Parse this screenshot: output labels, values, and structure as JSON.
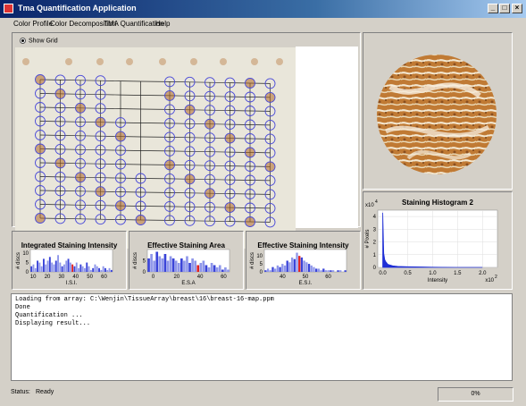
{
  "window": {
    "title": "Tma Quantification Application",
    "minimize_label": "_",
    "maximize_label": "□",
    "close_label": "×"
  },
  "menu": {
    "items": [
      "Color Profile",
      "Color Decomposition",
      "TMA Quantification",
      "Help"
    ]
  },
  "grid_panel": {
    "show_grid_label": "Show Grid",
    "show_grid_checked": true
  },
  "colors": {
    "grid_circle": "#4a4ad8",
    "stain": "#b06a2a",
    "hist_blue": "#1f2fd6",
    "highlight_red": "#e02020"
  },
  "histograms": [
    {
      "title": "Integrated Staining Intensity",
      "ylabel": "# discs",
      "xlabel": "I.S.I.",
      "xticks": [
        "10",
        "20",
        "30",
        "40",
        "50",
        "60"
      ],
      "yticks": [
        "0",
        "5",
        "10"
      ],
      "values": [
        3,
        4,
        2,
        6,
        5,
        3,
        7,
        4,
        6,
        8,
        5,
        4,
        6,
        9,
        5,
        3,
        4,
        6,
        7,
        5,
        4,
        3,
        5,
        2,
        4,
        3,
        2,
        5,
        3,
        1,
        2,
        4,
        3,
        2,
        1,
        3,
        2,
        1,
        2,
        1
      ],
      "highlight_index": 20
    },
    {
      "title": "Effective Staining Area",
      "ylabel": "# discs",
      "xlabel": "E.S.A",
      "xticks": [
        "0",
        "20",
        "40",
        "60"
      ],
      "yticks": [
        "0",
        "5"
      ],
      "values": [
        6,
        8,
        5,
        9,
        7,
        6,
        8,
        5,
        7,
        6,
        5,
        4,
        6,
        5,
        7,
        4,
        6,
        5,
        3,
        4,
        5,
        3,
        2,
        4,
        3,
        2,
        3,
        1,
        2,
        1
      ],
      "highlight_index": 18
    },
    {
      "title": "Effective Staining Intensity",
      "ylabel": "# discs",
      "xlabel": "E.S.I.",
      "xticks": [
        "40",
        "50",
        "60"
      ],
      "yticks": [
        "0",
        "5",
        "10"
      ],
      "values": [
        1,
        2,
        1,
        3,
        2,
        4,
        3,
        5,
        4,
        7,
        6,
        9,
        8,
        12,
        10,
        9,
        7,
        6,
        5,
        4,
        3,
        2,
        2,
        1,
        2,
        1,
        1,
        1,
        1,
        0,
        1,
        1,
        0,
        1
      ],
      "highlight_index": 14
    }
  ],
  "staining_histogram": {
    "title": "Staining Histogram 2",
    "ylabel": "# Pixels",
    "xlabel": "Intensity",
    "y_multiplier": "x10",
    "y_multiplier_exp": "4",
    "x_multiplier": "x10",
    "x_multiplier_exp": "2",
    "xticks": [
      "0.0",
      "0.5",
      "1.0",
      "1.5",
      "2.0"
    ],
    "yticks": [
      "0",
      "1",
      "2",
      "3",
      "4"
    ],
    "ylim": [
      0,
      4.5
    ],
    "xlim": [
      -0.1,
      2.3
    ]
  },
  "chart_data": [
    {
      "type": "bar",
      "title": "Integrated Staining Intensity",
      "xlabel": "I.S.I.",
      "ylabel": "# discs",
      "x_range": [
        8,
        66
      ],
      "ylim": [
        0,
        12
      ],
      "values": [
        3,
        4,
        2,
        6,
        5,
        3,
        7,
        4,
        6,
        8,
        5,
        4,
        6,
        9,
        5,
        3,
        4,
        6,
        7,
        5,
        4,
        3,
        5,
        2,
        4,
        3,
        2,
        5,
        3,
        1,
        2,
        4,
        3,
        2,
        1,
        3,
        2,
        1,
        2,
        1
      ]
    },
    {
      "type": "bar",
      "title": "Effective Staining Area",
      "xlabel": "E.S.A",
      "ylabel": "# discs",
      "x_range": [
        -5,
        65
      ],
      "ylim": [
        0,
        10
      ],
      "values": [
        6,
        8,
        5,
        9,
        7,
        6,
        8,
        5,
        7,
        6,
        5,
        4,
        6,
        5,
        7,
        4,
        6,
        5,
        3,
        4,
        5,
        3,
        2,
        4,
        3,
        2,
        3,
        1,
        2,
        1
      ]
    },
    {
      "type": "bar",
      "title": "Effective Staining Intensity",
      "xlabel": "E.S.I.",
      "ylabel": "# discs",
      "x_range": [
        32,
        68
      ],
      "ylim": [
        0,
        14
      ],
      "values": [
        1,
        2,
        1,
        3,
        2,
        4,
        3,
        5,
        4,
        7,
        6,
        9,
        8,
        12,
        10,
        9,
        7,
        6,
        5,
        4,
        3,
        2,
        2,
        1,
        2,
        1,
        1,
        1,
        1,
        0,
        1,
        1,
        0,
        1
      ]
    },
    {
      "type": "area",
      "title": "Staining Histogram 2",
      "xlabel": "Intensity",
      "ylabel": "# Pixels",
      "xlim": [
        -0.1,
        2.3
      ],
      "ylim": [
        0,
        4.5
      ],
      "x": [
        0.0,
        0.02,
        0.04,
        0.06,
        0.08,
        0.1,
        0.15,
        0.2,
        0.3,
        0.5,
        0.8,
        1.0,
        1.2,
        1.5,
        2.0
      ],
      "y": [
        4.3,
        1.1,
        0.6,
        0.45,
        0.35,
        0.25,
        0.18,
        0.12,
        0.08,
        0.05,
        0.03,
        0.02,
        0.01,
        0.0,
        0.0
      ]
    }
  ],
  "console": {
    "lines": [
      "Loading from array: C:\\Wenjin\\TissueArray\\breast\\16\\breast-16-map.ppm",
      "Done",
      "Quantification ...",
      "Displaying result..."
    ]
  },
  "status": {
    "label": "Status:",
    "value": "Ready",
    "progress_text": "0%",
    "progress_value": 0
  }
}
